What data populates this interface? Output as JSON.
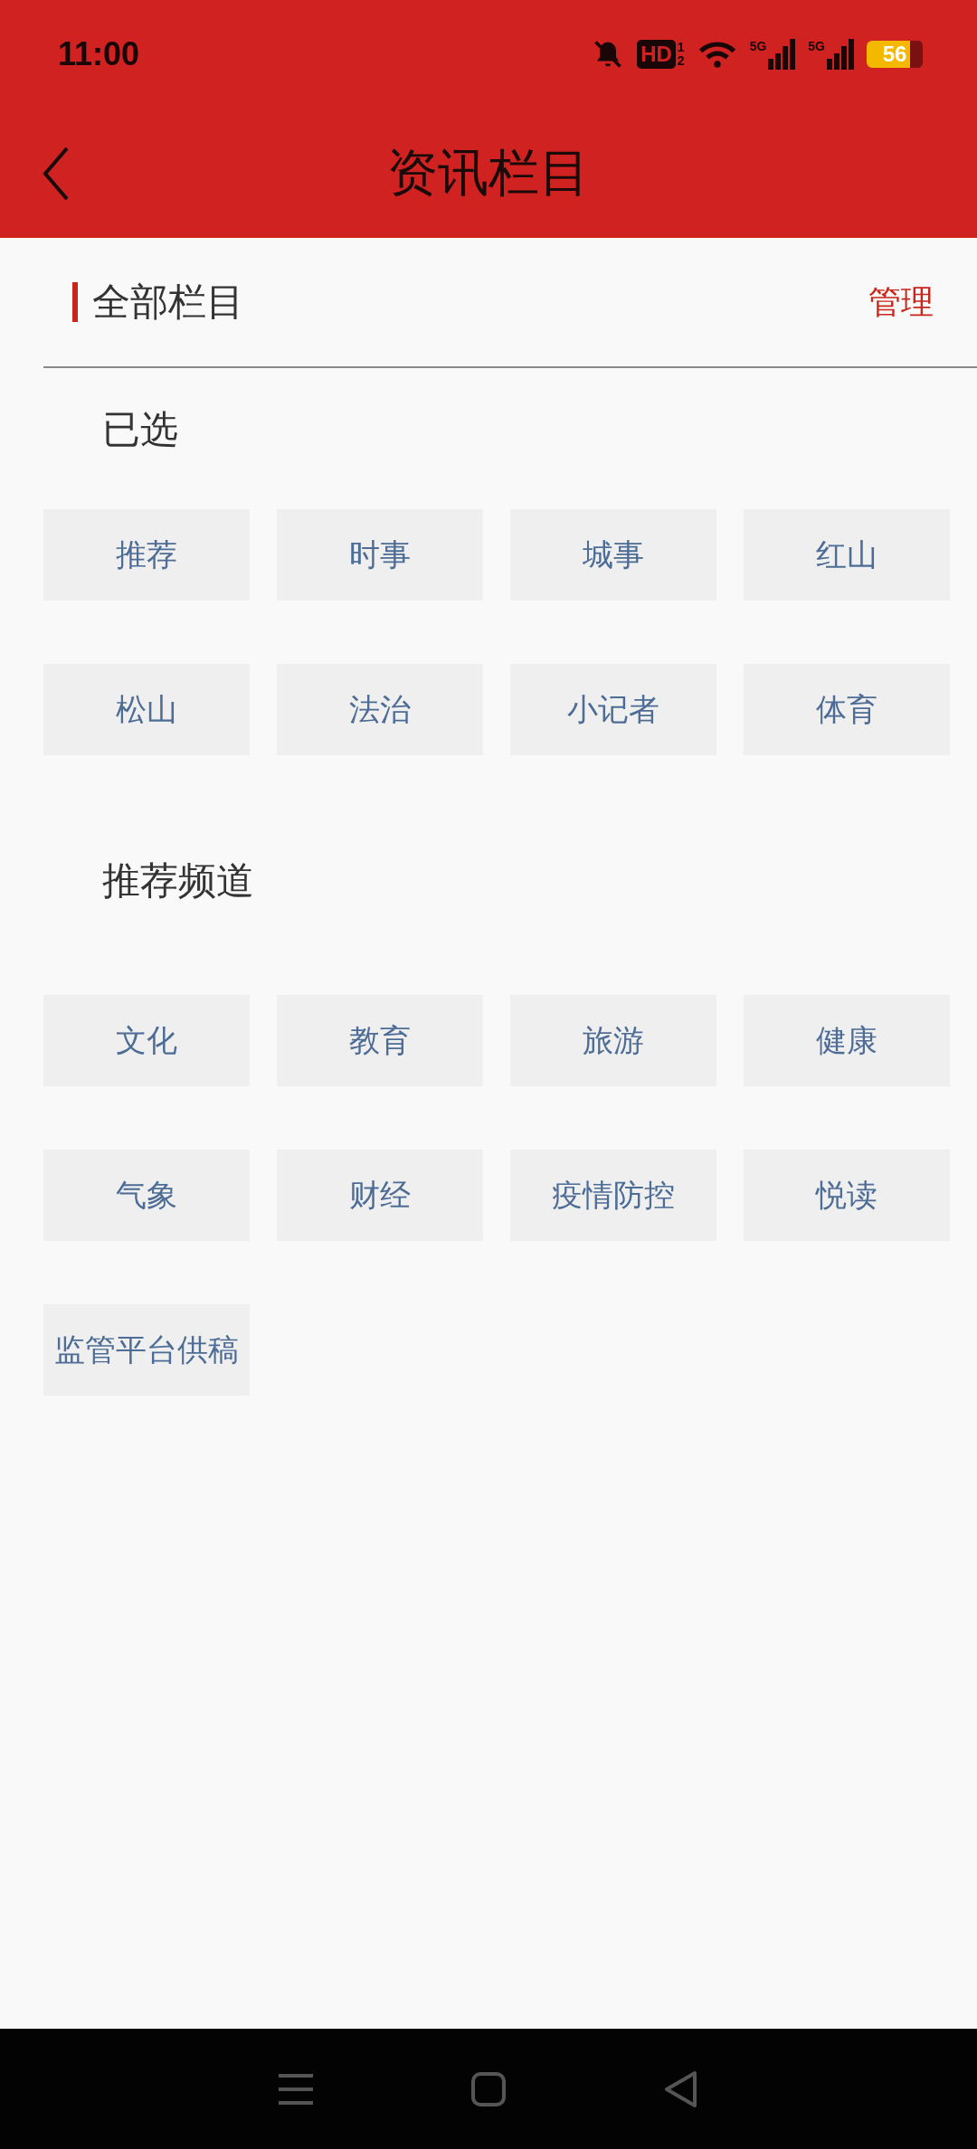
{
  "status_bar": {
    "time": "11:00",
    "hd_label": "HD",
    "hd_sub": [
      "1",
      "2"
    ],
    "network_labels": [
      "5G",
      "5G"
    ],
    "battery": "56"
  },
  "header": {
    "title": "资讯栏目"
  },
  "section": {
    "title": "全部栏目",
    "action": "管理"
  },
  "groups": [
    {
      "title": "已选",
      "channels": [
        "推荐",
        "时事",
        "城事",
        "红山",
        "松山",
        "法治",
        "小记者",
        "体育"
      ]
    },
    {
      "title": "推荐频道",
      "channels": [
        "文化",
        "教育",
        "旅游",
        "健康",
        "气象",
        "财经",
        "疫情防控",
        "悦读",
        "监管平台供稿"
      ]
    }
  ]
}
